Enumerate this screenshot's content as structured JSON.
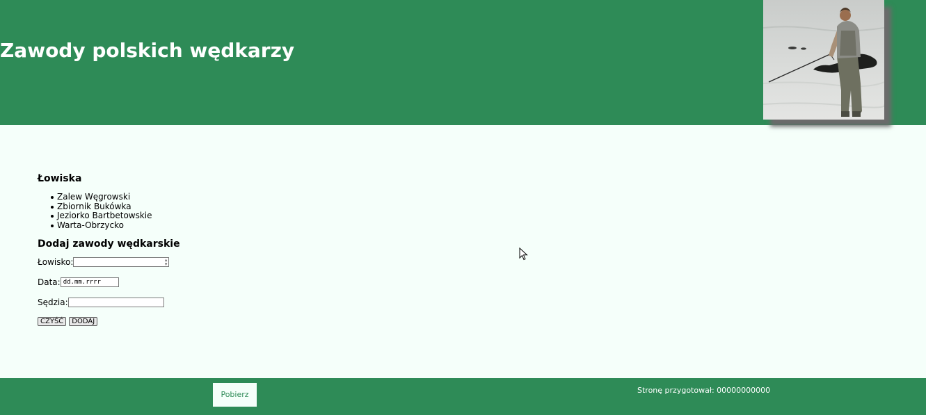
{
  "header": {
    "title": "Zawody polskich wędkarzy"
  },
  "fishing_spots": {
    "heading": "Łowiska",
    "items": [
      "Zalew Węgrowski",
      "Zbiornik Bukówka",
      "Jeziorko Bartbetowskie",
      "Warta-Obrzycko"
    ]
  },
  "form": {
    "heading": "Dodaj zawody wędkarskie",
    "spot_label": "Łowisko:",
    "spot_value": "",
    "date_label": "Data:",
    "date_placeholder": "dd.mm.rrrr",
    "judge_label": "Sędzia:",
    "judge_value": "",
    "clear_button": "CZYŚĆ",
    "add_button": "DODAJ"
  },
  "footer": {
    "download_link": "Pobierz",
    "author": "Stronę przygotował: 00000000000"
  },
  "colors": {
    "primary": "#2e8b57",
    "background": "#f5fffa"
  }
}
